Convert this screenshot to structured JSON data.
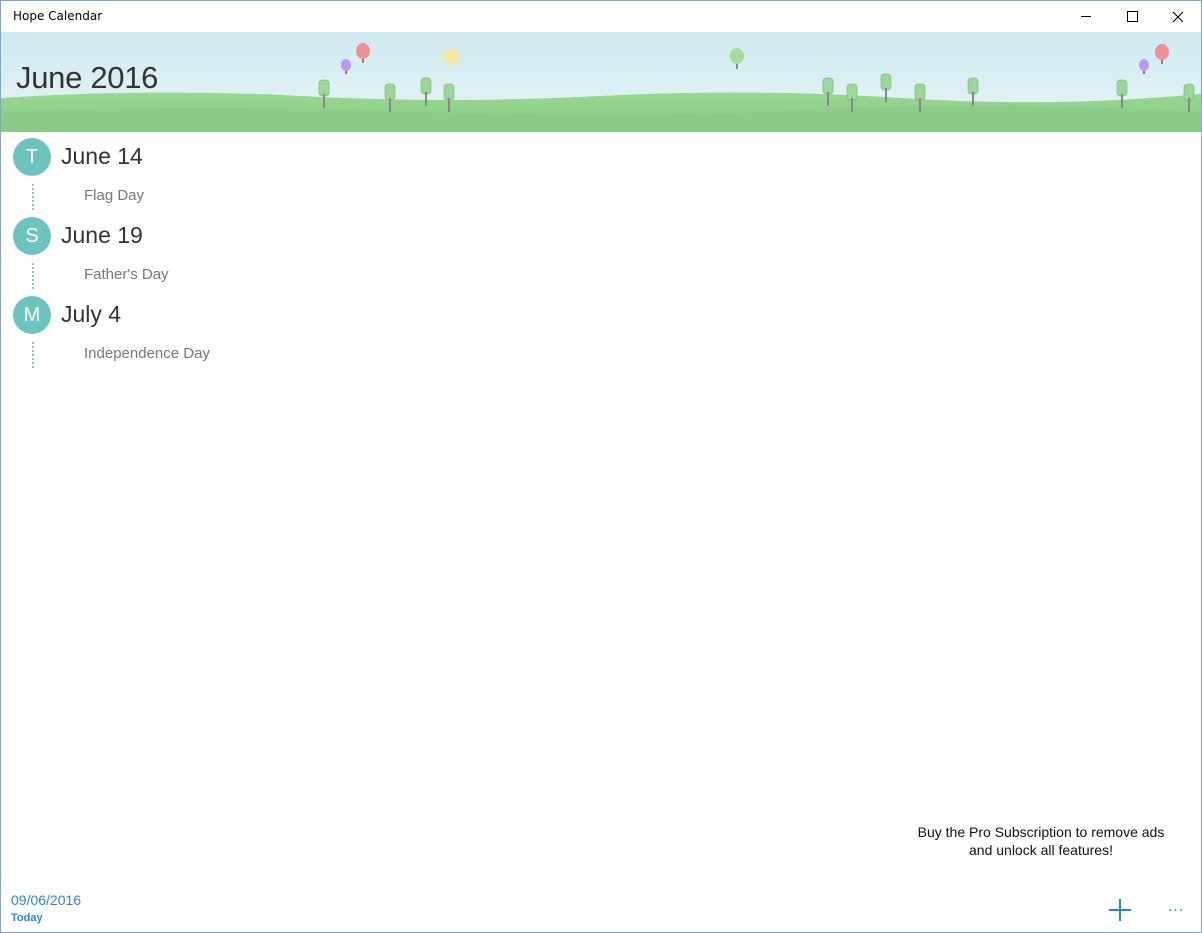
{
  "window": {
    "title": "Hope Calendar"
  },
  "header": {
    "month_title": "June 2016"
  },
  "events": [
    {
      "day_letter": "T",
      "date": "June 14",
      "name": "Flag Day"
    },
    {
      "day_letter": "S",
      "date": "June 19",
      "name": "Father's Day"
    },
    {
      "day_letter": "M",
      "date": "July 4",
      "name": "Independence Day"
    }
  ],
  "footer": {
    "promo_line1": "Buy the Pro Subscription to remove ads",
    "promo_line2": "and unlock all features!",
    "today_date": "09/06/2016",
    "today_label": "Today",
    "more_label": "..."
  },
  "colors": {
    "accent": "#2b86d1",
    "badge": "#6dc4be",
    "grass": "#8ed18b",
    "sky": "#d6eef4"
  },
  "icons": {
    "add": "plus-icon",
    "more": "ellipsis-icon",
    "minimize": "minimize-icon",
    "maximize": "maximize-icon",
    "close": "close-icon"
  }
}
